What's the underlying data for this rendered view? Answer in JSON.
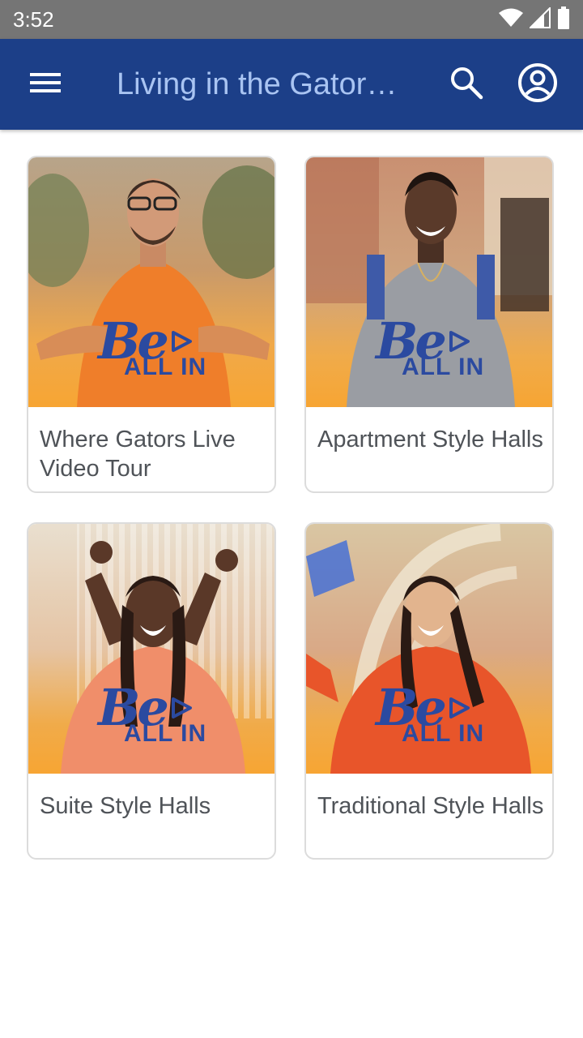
{
  "status_bar": {
    "time": "3:52",
    "icons": [
      "wifi-icon",
      "cellular-icon",
      "battery-icon"
    ]
  },
  "app_bar": {
    "title": "Living in the Gator…",
    "icons": [
      "menu-icon",
      "search-icon",
      "account-icon"
    ],
    "colors": {
      "background": "#1c3f88",
      "title": "#a9c4f2"
    }
  },
  "cards": [
    {
      "title": "Where Gators Live Video Tour",
      "logo_be": "Be",
      "logo_allin": "ALL IN"
    },
    {
      "title": "Apartment Style Halls",
      "logo_be": "Be",
      "logo_allin": "ALL IN"
    },
    {
      "title": "Suite Style Halls",
      "logo_be": "Be",
      "logo_allin": "ALL IN"
    },
    {
      "title": "Traditional Style Halls",
      "logo_be": "Be",
      "logo_allin": "ALL IN"
    }
  ]
}
